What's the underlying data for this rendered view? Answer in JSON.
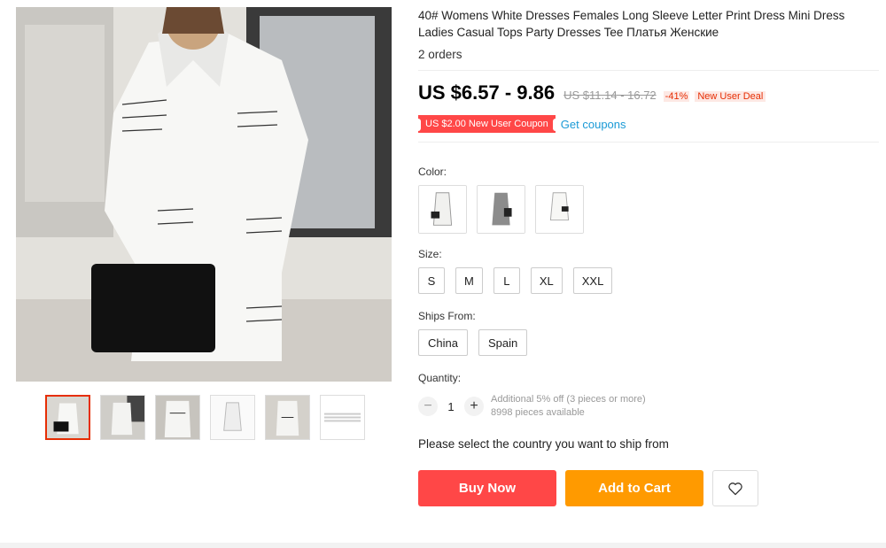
{
  "product": {
    "title": "40# Womens White Dresses Females Long Sleeve Letter Print Dress Mini Dress Ladies Casual Tops Party Dresses Tee Платья Женские",
    "orders": "2 orders",
    "main_image_icon": "product-photo-woman-white-letter-print-dress",
    "thumbnails": [
      {
        "icon": "thumb-front-view",
        "active": true
      },
      {
        "icon": "thumb-side-view",
        "active": false
      },
      {
        "icon": "thumb-detail-view",
        "active": false
      },
      {
        "icon": "thumb-full-view",
        "active": false
      },
      {
        "icon": "thumb-back-view",
        "active": false
      },
      {
        "icon": "thumb-size-chart",
        "active": false
      }
    ]
  },
  "price": {
    "current": "US $6.57 - 9.86",
    "original": "US $11.14 - 16.72",
    "discount": "-41%",
    "deal_badge": "New User Deal"
  },
  "coupon": {
    "label": "US $2.00 New User Coupon",
    "link": "Get coupons"
  },
  "color": {
    "label": "Color:",
    "options": [
      "swatch-white-print",
      "swatch-grey-print",
      "swatch-white-mini"
    ]
  },
  "size": {
    "label": "Size:",
    "options": [
      "S",
      "M",
      "L",
      "XL",
      "XXL"
    ]
  },
  "ships_from": {
    "label": "Ships From:",
    "options": [
      "China",
      "Spain"
    ]
  },
  "quantity": {
    "label": "Quantity:",
    "minus": "−",
    "value": "1",
    "plus": "+",
    "discount_note": "Additional 5% off (3 pieces or more)",
    "available": "8998 pieces available"
  },
  "shipping_note": "Please select the country you want to ship from",
  "actions": {
    "buy_now": "Buy Now",
    "add_to_cart": "Add to Cart",
    "wishlist_icon": "heart-icon"
  },
  "colors": {
    "accent_red": "#ff4747",
    "cart_orange": "#ff9a00",
    "link_blue": "#1a9ad6"
  }
}
